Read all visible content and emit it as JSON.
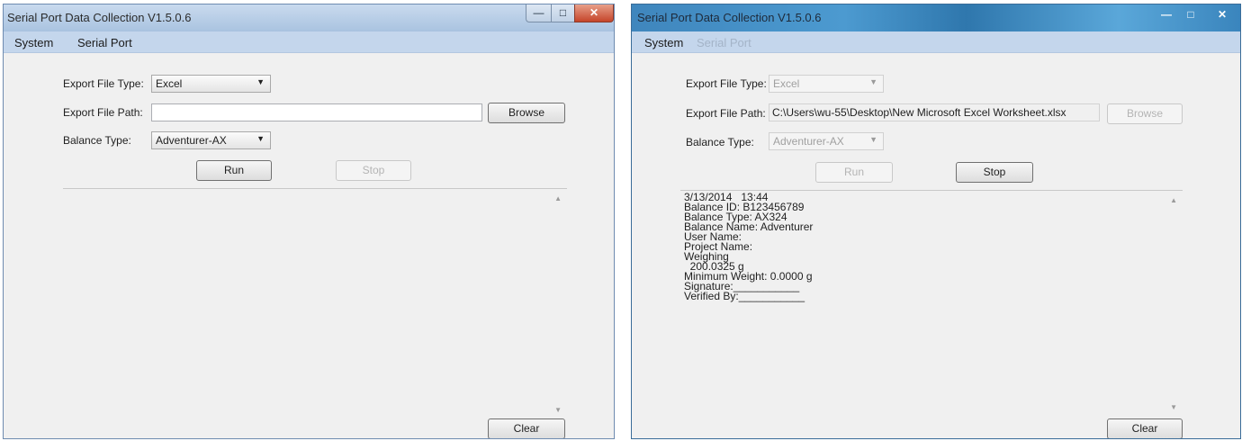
{
  "left_window": {
    "title": "Serial Port Data Collection  V1.5.0.6",
    "menu": [
      "System",
      "Serial Port"
    ],
    "export_file_type_label": "Export File Type:",
    "export_file_type_value": "Excel",
    "export_file_path_label": "Export File Path:",
    "export_file_path_value": "",
    "browse_label": "Browse",
    "balance_type_label": "Balance Type:",
    "balance_type_value": "Adventurer-AX",
    "run_label": "Run",
    "stop_label": "Stop",
    "clear_label": "Clear"
  },
  "right_window": {
    "title": "Serial Port Data Collection  V1.5.0.6",
    "menu": [
      "System",
      "Serial Port"
    ],
    "export_file_type_label": "Export File Type:",
    "export_file_type_value": "Excel",
    "export_file_path_label": "Export File Path:",
    "export_file_path_value": "C:\\Users\\wu-55\\Desktop\\New Microsoft Excel Worksheet.xlsx",
    "browse_label": "Browse",
    "balance_type_label": "Balance Type:",
    "balance_type_value": "Adventurer-AX",
    "run_label": "Run",
    "stop_label": "Stop",
    "clear_label": "Clear",
    "output_lines": [
      "3/13/2014   13:44",
      "Balance ID: B123456789",
      "Balance Type: AX324",
      "Balance Name: Adventurer",
      "User Name:",
      "Project Name:",
      "Weighing",
      "  200.0325 g",
      "Minimum Weight: 0.0000 g",
      "Signature:___________",
      "Verified By:___________"
    ]
  },
  "icons": {
    "minimize": "minimize-icon",
    "maximize": "maximize-icon",
    "close": "close-icon",
    "dropdown": "chevron-down-icon",
    "scroll_up": "scroll-up-arrow-icon",
    "scroll_down": "scroll-down-arrow-icon"
  }
}
